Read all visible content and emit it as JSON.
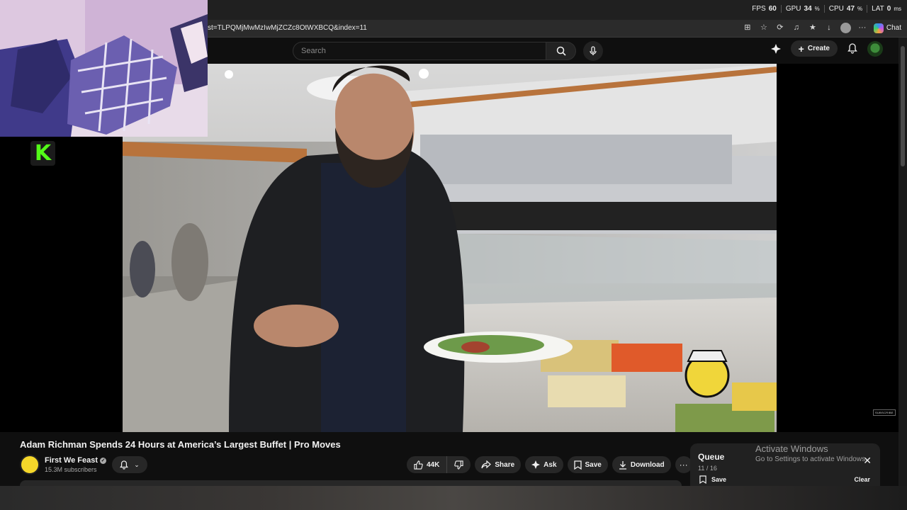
{
  "perf": {
    "fps_label": "FPS",
    "fps_value": "60",
    "gpu_label": "GPU",
    "gpu_value": "34",
    "cpu_label": "CPU",
    "cpu_value": "47",
    "lat_label": "LAT",
    "lat_value": "0"
  },
  "browser": {
    "url": "st=TLPQMjMwMzIwMjZCZc8OtWXBCQ&index=11",
    "chat_label": "Chat"
  },
  "header": {
    "search_placeholder": "Search",
    "create_label": "Create"
  },
  "video": {
    "title": "Adam Richman Spends 24 Hours at America’s Largest Buffet | Pro Moves",
    "subscribe_watermark": "SUBSCRIBE"
  },
  "channel": {
    "name": "First We Feast",
    "subscribers": "15.3M subscribers"
  },
  "actions": {
    "likes": "44K",
    "share": "Share",
    "ask": "Ask",
    "save": "Save",
    "download": "Download"
  },
  "queue": {
    "title": "Queue",
    "count": "11 / 16",
    "save": "Save",
    "clear": "Clear"
  },
  "watermark": {
    "line1": "Activate Windows",
    "line2": "Go to Settings to activate Windows."
  },
  "colors": {
    "background": "#0f0f0f",
    "pill": "#272727",
    "kick_green": "#53fc18"
  }
}
